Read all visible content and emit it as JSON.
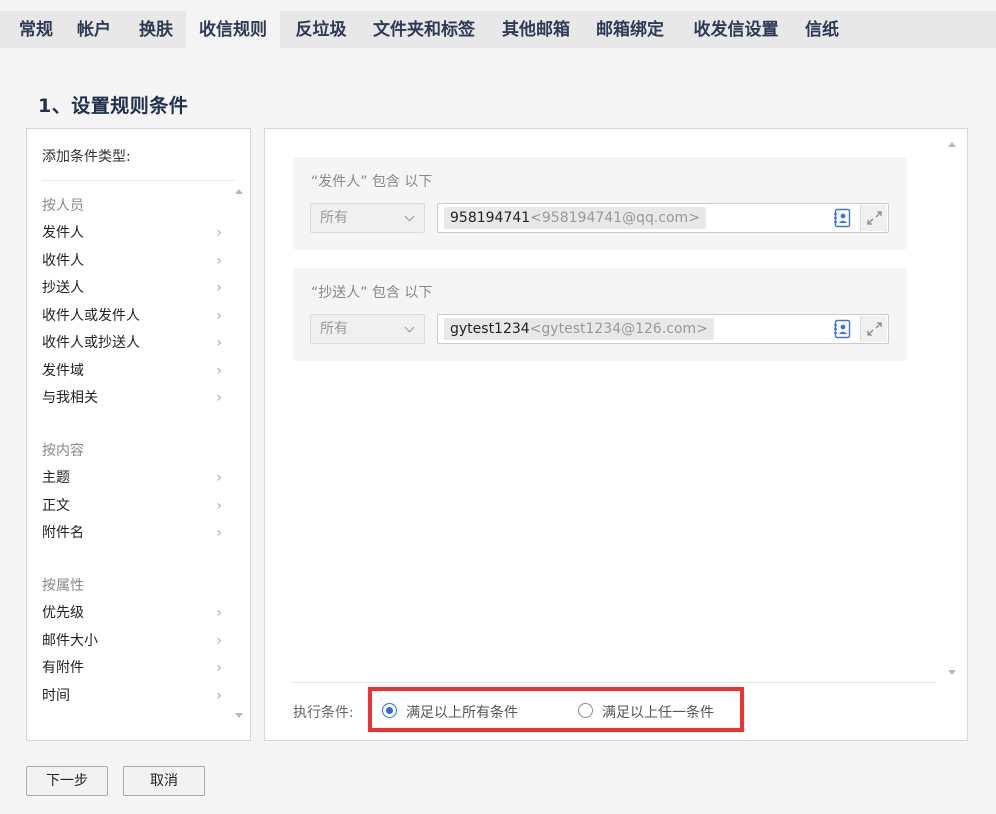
{
  "tabs": [
    {
      "label": "常规"
    },
    {
      "label": "帐户"
    },
    {
      "label": "换肤"
    },
    {
      "label": "收信规则",
      "active": true
    },
    {
      "label": "反垃圾"
    },
    {
      "label": "文件夹和标签"
    },
    {
      "label": "其他邮箱"
    },
    {
      "label": "邮箱绑定"
    },
    {
      "label": "收发信设置"
    },
    {
      "label": "信纸"
    }
  ],
  "section_title": "1、设置规则条件",
  "condition_panel": {
    "heading": "添加条件类型:",
    "groups": [
      {
        "title": "按人员",
        "items": [
          "发件人",
          "收件人",
          "抄送人",
          "收件人或发件人",
          "收件人或抄送人",
          "发件域",
          "与我相关"
        ]
      },
      {
        "title": "按内容",
        "items": [
          "主题",
          "正文",
          "附件名"
        ]
      },
      {
        "title": "按属性",
        "items": [
          "优先级",
          "邮件大小",
          "有附件",
          "时间"
        ]
      }
    ],
    "chevron": "›"
  },
  "rules": [
    {
      "label": "“发件人” 包含 以下",
      "select_value": "所有",
      "chip_name": "958194741",
      "chip_email": "<958194741@qq.com>"
    },
    {
      "label": "“抄送人” 包含 以下",
      "select_value": "所有",
      "chip_name": "gytest1234",
      "chip_email": "<gytest1234@126.com>"
    }
  ],
  "execution": {
    "label": "执行条件:",
    "options": [
      {
        "label": "满足以上所有条件",
        "checked": true
      },
      {
        "label": "满足以上任一条件",
        "checked": false
      }
    ]
  },
  "buttons": {
    "next": "下一步",
    "cancel": "取消"
  },
  "colors": {
    "accent": "#2a6de0",
    "highlight": "#ee3030",
    "title": "#20314f"
  },
  "icons": [
    "contact-book-icon",
    "expand-icon",
    "chevron-right-icon",
    "scroll-up-icon",
    "scroll-down-icon"
  ]
}
